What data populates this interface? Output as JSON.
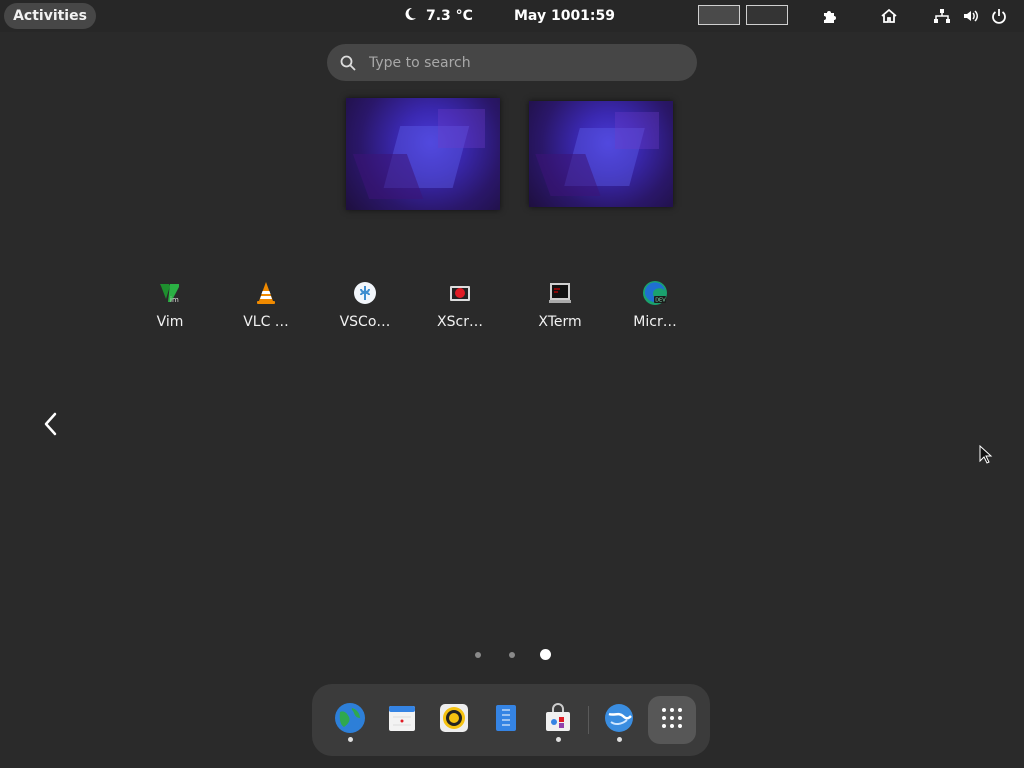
{
  "topbar": {
    "activities_label": "Activities",
    "weather_icon": "moon-icon",
    "temperature": "7.3 °C",
    "date": "May 10",
    "time": "01:59",
    "workspaces": [
      "workspace-1",
      "workspace-2"
    ],
    "tray_icons": [
      "extensions-icon",
      "home-icon",
      "network-icon",
      "volume-icon",
      "power-icon"
    ]
  },
  "search": {
    "placeholder": "Type to search",
    "value": ""
  },
  "app_grid": {
    "apps": [
      {
        "label": "Vim",
        "icon": "vim-icon"
      },
      {
        "label": "VLC …",
        "icon": "vlc-icon"
      },
      {
        "label": "VSCo…",
        "icon": "vscodium-icon"
      },
      {
        "label": "XScr…",
        "icon": "xscreensaver-icon"
      },
      {
        "label": "XTerm",
        "icon": "xterm-icon"
      },
      {
        "label": "Micr…",
        "icon": "microsoft-edge-dev-icon"
      }
    ],
    "page_count": 3,
    "current_page": 3
  },
  "dash": {
    "items": [
      {
        "icon": "browser-globe-icon",
        "running": true
      },
      {
        "icon": "calendar-icon",
        "running": false
      },
      {
        "icon": "rhythmbox-icon",
        "running": false
      },
      {
        "icon": "text-editor-icon",
        "running": false
      },
      {
        "icon": "software-store-icon",
        "running": true
      },
      {
        "icon": "remote-globe-icon",
        "running": true
      }
    ],
    "show_apps_icon": "app-grid-icon"
  },
  "colors": {
    "background": "#2a2a2a",
    "topbar": "#272727",
    "dash": "#3b3b3b",
    "search": "#464646"
  }
}
